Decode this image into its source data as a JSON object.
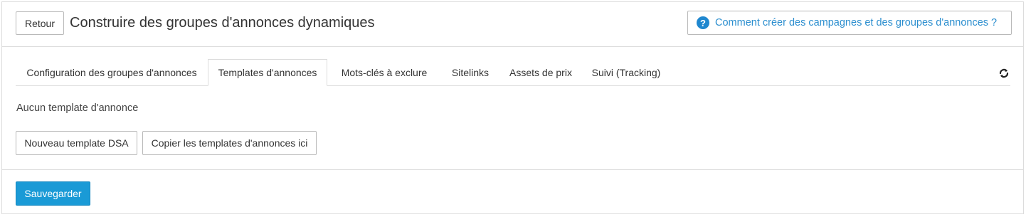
{
  "header": {
    "back_label": "Retour",
    "title": "Construire des groupes d'annonces dynamiques",
    "help_link_label": "Comment créer des campagnes et des groupes d'annonces ?",
    "help_icon": "question-circle-icon",
    "help_icon_glyph": "?"
  },
  "tabs": [
    {
      "label": "Configuration des groupes d'annonces",
      "active": false
    },
    {
      "label": "Templates d'annonces",
      "active": true
    },
    {
      "label": "Mots-clés à exclure",
      "active": false
    },
    {
      "label": "Sitelinks",
      "active": false
    },
    {
      "label": "Assets de prix",
      "active": false
    },
    {
      "label": "Suivi (Tracking)",
      "active": false
    }
  ],
  "content": {
    "empty_message": "Aucun template d'annonce",
    "new_template_label": "Nouveau template DSA",
    "copy_templates_label": "Copier les templates d'annonces ici"
  },
  "footer": {
    "save_label": "Sauvegarder"
  },
  "colors": {
    "accent": "#1a9ad6",
    "link": "#2b8ecf",
    "border": "#dcdcdc"
  }
}
